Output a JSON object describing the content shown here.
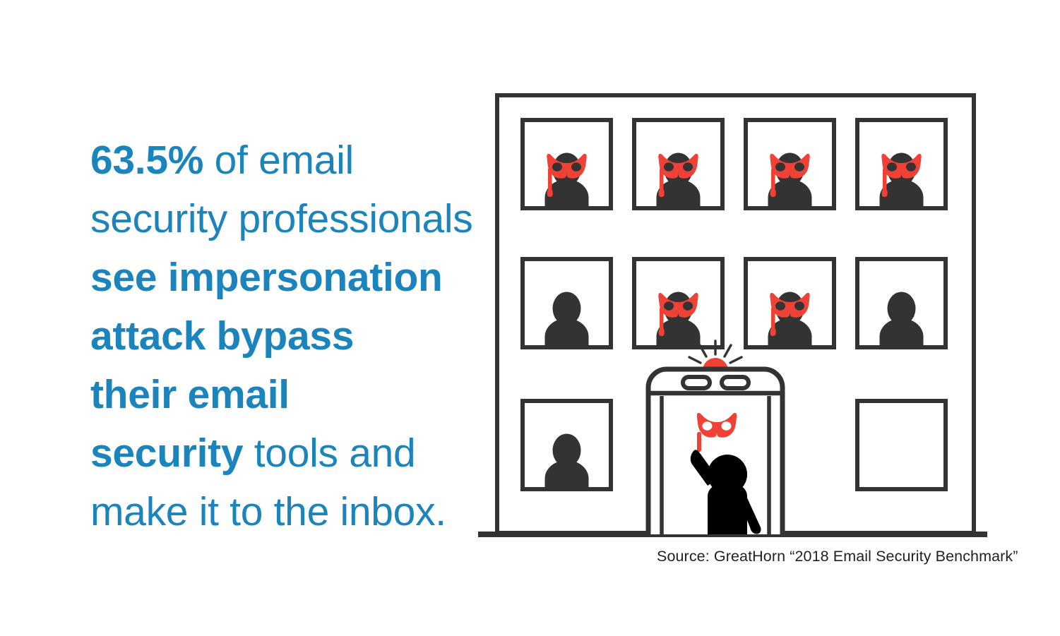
{
  "headline": {
    "color": "#1b84bd",
    "lines": [
      [
        {
          "t": "63.5%",
          "bold": true
        },
        {
          "t": " of email",
          "bold": false
        }
      ],
      [
        {
          "t": "security professionals",
          "bold": false
        }
      ],
      [
        {
          "t": "see impersonation",
          "bold": true
        }
      ],
      [
        {
          "t": "attack bypass",
          "bold": true
        }
      ],
      [
        {
          "t": "their email",
          "bold": true
        }
      ],
      [
        {
          "t": "security",
          "bold": true
        },
        {
          "t": " tools and",
          "bold": false
        }
      ],
      [
        {
          "t": "make it to the inbox.",
          "bold": false
        }
      ]
    ],
    "statistic": "63.5%",
    "plain_text": "63.5% of email security professionals see impersonation attack bypass their email security tools and make it to the inbox."
  },
  "source": {
    "text": "Source: GreatHorn “2018 Email Security Benchmark”",
    "color": "#231f20"
  },
  "illustration": {
    "name": "office-building-with-security-scanner",
    "colors": {
      "outline": "#333333",
      "figure": "#333333",
      "mask_red": "#ef4136",
      "alarm_red": "#ef4136",
      "person_black": "#000000",
      "background": "#ffffff"
    },
    "building": {
      "rows": [
        {
          "row": 1,
          "windows": [
            {
              "index": 1,
              "occupant": "masked-figure"
            },
            {
              "index": 2,
              "occupant": "masked-figure"
            },
            {
              "index": 3,
              "occupant": "masked-figure"
            },
            {
              "index": 4,
              "occupant": "masked-figure"
            }
          ]
        },
        {
          "row": 2,
          "windows": [
            {
              "index": 1,
              "occupant": "plain-figure"
            },
            {
              "index": 2,
              "occupant": "masked-figure"
            },
            {
              "index": 3,
              "occupant": "masked-figure"
            },
            {
              "index": 4,
              "occupant": "plain-figure"
            }
          ]
        },
        {
          "row": 3,
          "windows": [
            {
              "index": 1,
              "occupant": "plain-figure"
            },
            {
              "index": 2,
              "occupant": "security-scanner"
            },
            {
              "index": 3,
              "occupant": "empty"
            }
          ]
        }
      ],
      "masked_count": 6,
      "plain_count": 3,
      "empty_count": 1
    },
    "scanner": {
      "name": "metal-detector-archway",
      "alarm": {
        "name": "alarm-light",
        "state": "active",
        "rays": 5
      },
      "slots": 2,
      "person": {
        "name": "person-holding-mask",
        "holds": "red-masquerade-mask"
      }
    }
  }
}
